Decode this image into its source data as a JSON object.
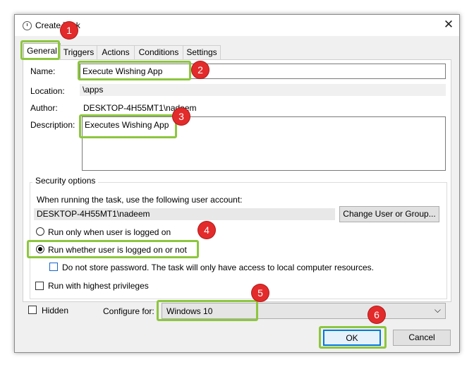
{
  "window": {
    "title": "Create Task",
    "close": "✕"
  },
  "tabs": [
    "General",
    "Triggers",
    "Actions",
    "Conditions",
    "Settings"
  ],
  "general": {
    "name_label": "Name:",
    "name_value": "Execute Wishing App",
    "location_label": "Location:",
    "location_value": "\\apps",
    "author_label": "Author:",
    "author_value": "DESKTOP-4H55MT1\\nadeem",
    "description_label": "Description:",
    "description_value": "Executes Wishing App"
  },
  "security": {
    "legend": "Security options",
    "account_prompt": "When running the task, use the following user account:",
    "account_value": "DESKTOP-4H55MT1\\nadeem",
    "change_button": "Change User or Group...",
    "run_logged_on": "Run only when user is logged on",
    "run_whether": "Run whether user is logged on or not",
    "run_whether_selected": true,
    "no_store_password": "Do not store password.  The task will only have access to local computer resources.",
    "highest_privileges": "Run with highest privileges"
  },
  "footer": {
    "hidden_label": "Hidden",
    "configure_label": "Configure for:",
    "configure_value": "Windows 10",
    "ok": "OK",
    "cancel": "Cancel"
  },
  "annotations": [
    "1",
    "2",
    "3",
    "4",
    "5",
    "6"
  ],
  "colors": {
    "highlight": "#8dc63f",
    "badge": "#e32b2b",
    "dialog_bg": "#f0f0f0"
  }
}
